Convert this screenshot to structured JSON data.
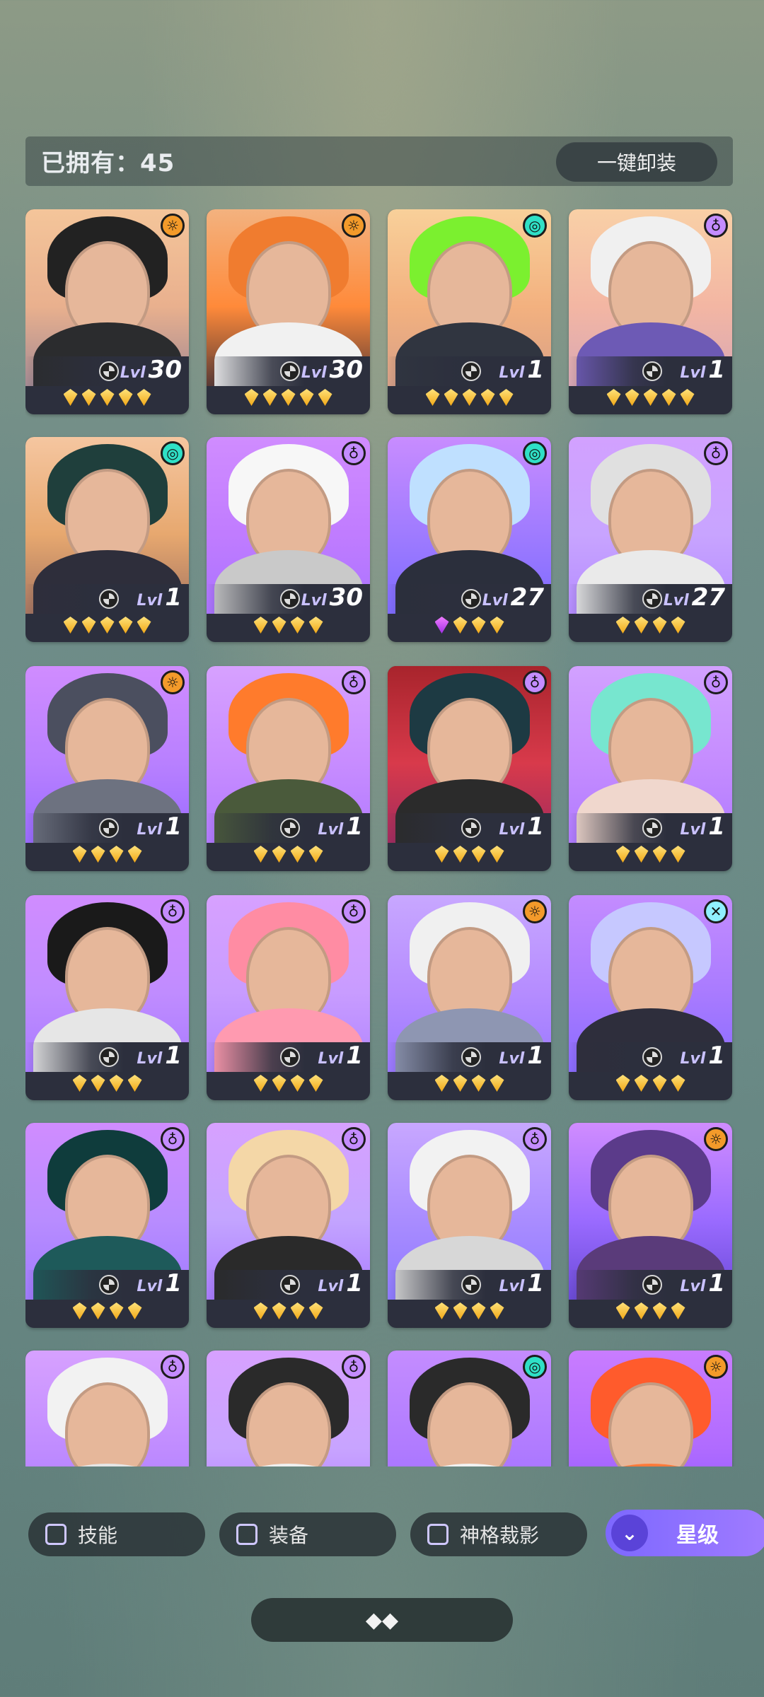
{
  "header": {
    "owned_text": "已拥有：45",
    "unequip_label": "一键卸装"
  },
  "cards": [
    {
      "role": "sun",
      "level": "30",
      "stars": 5,
      "bg": [
        "#f4c59a",
        "#e9b08e",
        "#a48a93"
      ],
      "hair": "#222222",
      "body": "#2b2c2e"
    },
    {
      "role": "sun",
      "level": "30",
      "stars": 5,
      "bg": [
        "#f3b27f",
        "#ff8a3a",
        "#5b3b36"
      ],
      "hair": "#f07c2f",
      "body": "#f1f1f1"
    },
    {
      "role": "swirl",
      "level": "1",
      "stars": 5,
      "bg": [
        "#f8d09a",
        "#f3b17f",
        "#d7a087"
      ],
      "hair": "#7bf02f",
      "body": "#303540"
    },
    {
      "role": "lotus",
      "level": "1",
      "stars": 5,
      "bg": [
        "#f9d0a6",
        "#f3b6a3",
        "#d8a7b5"
      ],
      "hair": "#f0f0f0",
      "body": "#6d5ab5"
    },
    {
      "role": "swirl",
      "level": "1",
      "stars": 5,
      "bg": [
        "#f5c6a0",
        "#e7a86f",
        "#a67561"
      ],
      "hair": "#1f3f3c",
      "body": "#2e2e3b"
    },
    {
      "role": "lotus",
      "level": "30",
      "stars": 4,
      "bg": [
        "#d08cff",
        "#c07cff",
        "#aa73ff"
      ],
      "hair": "#f7f7f7",
      "body": "#c9c9c9"
    },
    {
      "role": "swirl",
      "level": "27",
      "stars": 4,
      "bg": [
        "#c88cff",
        "#9f7bff",
        "#7e6bff"
      ],
      "hair": "#bfe0ff",
      "body": "#2b2f3c"
    },
    {
      "role": "lotus",
      "level": "27",
      "stars": 4,
      "bg": [
        "#d2a1ff",
        "#c8a4ff",
        "#b48cff"
      ],
      "hair": "#e0e0e0",
      "body": "#eaeaea"
    },
    {
      "role": "sun",
      "level": "1",
      "stars": 4,
      "bg": [
        "#d08cff",
        "#b880ff",
        "#9a6bff"
      ],
      "hair": "#4b4f5f",
      "body": "#6d7280"
    },
    {
      "role": "lotus",
      "level": "1",
      "stars": 4,
      "bg": [
        "#d7a1ff",
        "#c78cff",
        "#b27aff"
      ],
      "hair": "#ff7b2c",
      "body": "#4a5a3b"
    },
    {
      "role": "lotus",
      "level": "1",
      "stars": 4,
      "bg": [
        "#a8242c",
        "#d83a4b",
        "#a12b5e"
      ],
      "hair": "#1d3a43",
      "body": "#2b2b2b"
    },
    {
      "role": "lotus",
      "level": "1",
      "stars": 4,
      "bg": [
        "#d2a1ff",
        "#c58cff",
        "#b07bff"
      ],
      "hair": "#77e6cf",
      "body": "#f0d7cd"
    },
    {
      "role": "lotus",
      "level": "1",
      "stars": 4,
      "bg": [
        "#d08cff",
        "#c08cff",
        "#a87bff"
      ],
      "hair": "#1a1a1a",
      "body": "#e6e6e6"
    },
    {
      "role": "lotus",
      "level": "1",
      "stars": 4,
      "bg": [
        "#d7a1ff",
        "#c89cff",
        "#b184ff"
      ],
      "hair": "#ff8ca3",
      "body": "#ff9ab0"
    },
    {
      "role": "sun",
      "level": "1",
      "stars": 4,
      "bg": [
        "#c8a7ff",
        "#b58cff",
        "#9a78ff"
      ],
      "hair": "#f0f0f0",
      "body": "#8e96b2"
    },
    {
      "role": "cross",
      "level": "1",
      "stars": 4,
      "bg": [
        "#c48cff",
        "#a97bff",
        "#8a6bff"
      ],
      "hair": "#c6c8ff",
      "body": "#2e2e3c"
    },
    {
      "role": "lotus",
      "level": "1",
      "stars": 4,
      "bg": [
        "#d08cff",
        "#b88cff",
        "#a07bff"
      ],
      "hair": "#0f3c3c",
      "body": "#1e5a5a"
    },
    {
      "role": "lotus",
      "level": "1",
      "stars": 4,
      "bg": [
        "#d7a1ff",
        "#c3a4ff",
        "#aa7bff"
      ],
      "hair": "#f4d7a7",
      "body": "#2a2a2a"
    },
    {
      "role": "lotus",
      "level": "1",
      "stars": 4,
      "bg": [
        "#c8a7ff",
        "#a98cff",
        "#8f7bff"
      ],
      "hair": "#f2f2f2",
      "body": "#d7d7d7"
    },
    {
      "role": "sun",
      "level": "1",
      "stars": 4,
      "bg": [
        "#d08cff",
        "#9a6bff",
        "#6b4ad8"
      ],
      "hair": "#5b3b8a",
      "body": "#5a3b7a"
    },
    {
      "role": "lotus",
      "level": "",
      "stars": 0,
      "bg": [
        "#d7a1ff",
        "#c08cff",
        "#a87bff"
      ],
      "hair": "#f2f2f2",
      "body": "#e6e6e6"
    },
    {
      "role": "lotus",
      "level": "",
      "stars": 0,
      "bg": [
        "#d7a1ff",
        "#c8a4ff",
        "#b07bff"
      ],
      "hair": "#2a2a2a",
      "body": "#f0f0f0"
    },
    {
      "role": "swirl",
      "level": "",
      "stars": 0,
      "bg": [
        "#c48cff",
        "#b07bff",
        "#9a6bff"
      ],
      "hair": "#2a2a2a",
      "body": "#f2f2f2"
    },
    {
      "role": "sun",
      "level": "",
      "stars": 0,
      "bg": [
        "#c97cff",
        "#b06bff",
        "#8a58ff"
      ],
      "hair": "#ff5b2c",
      "body": "#ff7a3a"
    }
  ],
  "filters": {
    "skill_label": "技能",
    "equip_label": "装备",
    "cut_label": "神格裁影",
    "star_label": "星级"
  },
  "expand": {
    "icon": "chevron-double-down-icon"
  }
}
